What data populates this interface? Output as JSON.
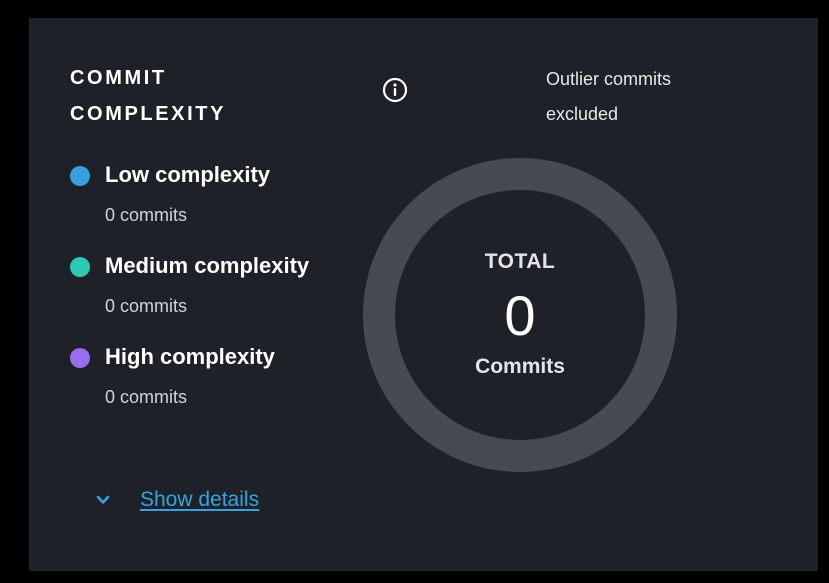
{
  "card": {
    "title_line1": "COMMIT",
    "title_line2": "COMPLEXITY",
    "info_icon": "info-circle-icon",
    "outlier_line1": "Outlier commits",
    "outlier_line2": "excluded"
  },
  "legend": {
    "items": [
      {
        "label": "Low complexity",
        "count": "0 commits",
        "color": "#34a0de"
      },
      {
        "label": "Medium complexity",
        "count": "0 commits",
        "color": "#2ec9b4"
      },
      {
        "label": "High complexity",
        "count": "0 commits",
        "color": "#9a6cf0"
      }
    ]
  },
  "donut": {
    "total_label": "TOTAL",
    "total_value": "0",
    "unit_label": "Commits",
    "ring_color": "#464b53"
  },
  "details": {
    "label": "Show details",
    "icon": "chevron-down-icon",
    "color": "#36a3e0"
  }
}
